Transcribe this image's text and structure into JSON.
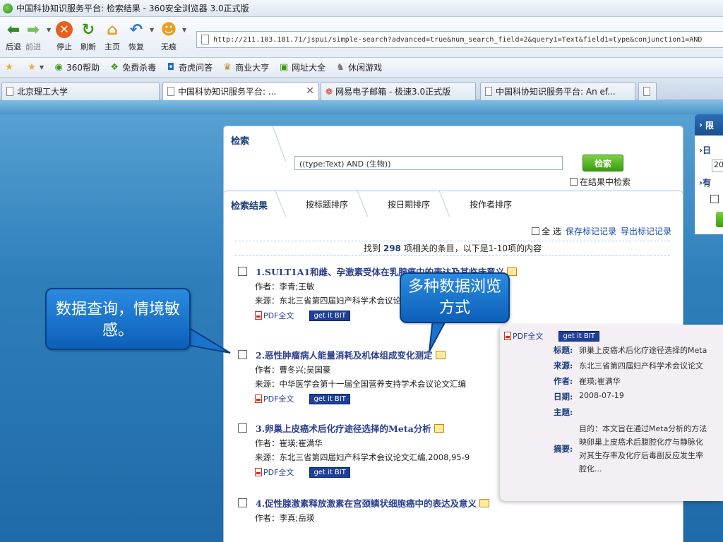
{
  "window": {
    "title": "中国科协知识服务平台: 检索结果 - 360安全浏览器 3.0正式版"
  },
  "toolbar": {
    "back": "后退",
    "forward": "前进",
    "stop": "停止",
    "refresh": "刷新",
    "home": "主页",
    "restore": "恢复",
    "incognito": "无痕",
    "address": "http://211.103.181.71/jspui/simple-search?advanced=true&num_search_field=2&query1=Text&field1=type&conjunction1=AND"
  },
  "favorites": [
    {
      "icon": "star-icon",
      "label": ""
    },
    {
      "icon": "add-favorite-icon",
      "label": ""
    },
    {
      "icon": "help-360-icon",
      "label": "360帮助"
    },
    {
      "icon": "antivirus-icon",
      "label": "免费杀毒"
    },
    {
      "icon": "qa-icon",
      "label": "奇虎问答"
    },
    {
      "icon": "business-icon",
      "label": "商业大亨"
    },
    {
      "icon": "directory-icon",
      "label": "网址大全"
    },
    {
      "icon": "game-icon",
      "label": "休闲游戏"
    }
  ],
  "tabs": [
    {
      "label": "北京理工大学"
    },
    {
      "label": "中国科协知识服务平台: ..."
    },
    {
      "label": "网易电子邮箱 - 极速3.0正式版"
    },
    {
      "label": "中国科协知识服务平台: An ef..."
    }
  ],
  "search": {
    "tab_label": "检索",
    "query": "((type:Text) AND (生物))",
    "button": "检索",
    "within_label": "在结果中检索"
  },
  "results_tabs": [
    "检索结果",
    "按标题排序",
    "按日期排序",
    "按作者排序"
  ],
  "select_all": "全 选",
  "save_marked": "保存标记记录",
  "export_marked": "导出标记记录",
  "found": {
    "prefix": "找到",
    "count": "298",
    "suffix": "项相关的条目，以下是1-10项的内容"
  },
  "results": [
    {
      "title": "1.SULT1A1和雌、孕激素受体在乳腺癌中的表达及其临床意义",
      "author_label": "作者：",
      "authors": "李青;王敏",
      "source_label": "来源：",
      "source": "东北三省第四届妇产科学术会议论文汇编,2008,17"
    },
    {
      "title": "2.恶性肿瘤病人能量消耗及机体组成变化测定",
      "author_label": "作者：",
      "authors": "曹冬兴;吴国豪",
      "source_label": "来源：",
      "source": "中华医学会第十一届全国营养支持学术会议论文汇编"
    },
    {
      "title": "3.卵巢上皮癌术后化疗途径选择的Meta分析",
      "author_label": "作者：",
      "authors": "崔瑛;崔满华",
      "source_label": "来源：",
      "source": "东北三省第四届妇产科学术会议论文汇编,2008,95-9"
    },
    {
      "title": "4.促性腺激素释放激素在宫颈鳞状细胞癌中的表达及意义",
      "author_label": "作者：",
      "authors": "李真;岳瑛",
      "source_label": "",
      "source": ""
    }
  ],
  "pdf_label": "PDF全文",
  "getit_label": "get it BIT",
  "popup": {
    "title_k": "标题:",
    "title_v": "卵巢上皮癌术后化疗途径选择的Meta",
    "source_k": "来源:",
    "source_v": "东北三省第四届妇产科学术会议论文",
    "author_k": "作者:",
    "author_v": "崔瑛;崔满华",
    "date_k": "日期:",
    "date_v": "2008-07-19",
    "subject_k": "主题:",
    "subject_v": "",
    "abstract_k": "摘要:",
    "abstract_lines": [
      "目的：本文旨在通过Meta分析的方法",
      "映卵巢上皮癌术后腹腔化疗与静脉化",
      "对其生存率及化疗后毒副反应发生率",
      "腔化..."
    ]
  },
  "sidebar": {
    "head": "限",
    "s1": "日",
    "input": "20",
    "s2": "有"
  },
  "callouts": {
    "left": "数据查询，情境敏感。",
    "center": "多种数据浏览方式"
  },
  "colors": {
    "accent_blue": "#1f6aa8",
    "button_green": "#3a9a14",
    "title_blue": "#2b3f8f"
  }
}
